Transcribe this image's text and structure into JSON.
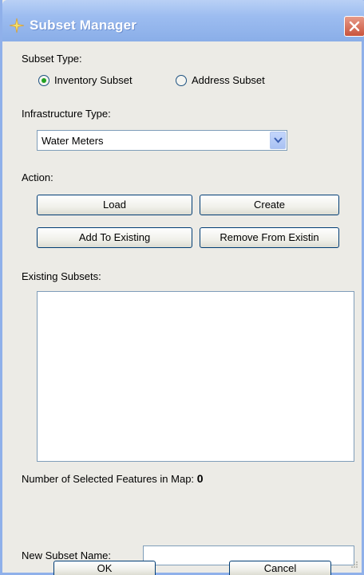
{
  "window": {
    "title": "Subset Manager"
  },
  "subset_type": {
    "label": "Subset Type:",
    "options": [
      {
        "label": "Inventory Subset",
        "selected": true
      },
      {
        "label": "Address Subset",
        "selected": false
      }
    ]
  },
  "infrastructure_type": {
    "label": "Infrastructure Type:",
    "selected": "Water Meters"
  },
  "action": {
    "label": "Action:",
    "load_label": "Load",
    "create_label": "Create",
    "add_label": "Add To Existing",
    "remove_label": "Remove  From Existin"
  },
  "existing_subsets": {
    "label": "Existing Subsets:",
    "items": []
  },
  "selected_features": {
    "label": "Number of Selected Features in Map:",
    "count": "0"
  },
  "new_subset": {
    "label": "New Subset Name:",
    "value": ""
  },
  "footer": {
    "ok_label": "OK",
    "cancel_label": "Cancel"
  },
  "colors": {
    "titlebar": "#9cbcf0",
    "dialog_bg": "#ecebe6",
    "radio_selected": "#21a121",
    "close_button": "#c9543d"
  }
}
